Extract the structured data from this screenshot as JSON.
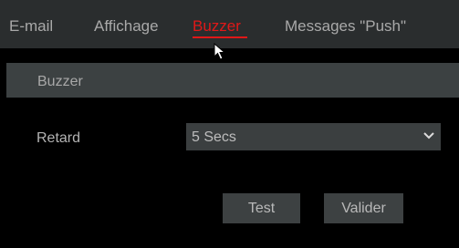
{
  "tabs": [
    {
      "label": "E-mail",
      "active": false
    },
    {
      "label": "Affichage",
      "active": false
    },
    {
      "label": "Buzzer",
      "active": true
    },
    {
      "label": "Messages \"Push\"",
      "active": false
    }
  ],
  "section": {
    "title": "Buzzer"
  },
  "form": {
    "delay_label": "Retard",
    "delay_value": "5 Secs"
  },
  "buttons": {
    "test_label": "Test",
    "submit_label": "Valider"
  },
  "colors": {
    "active_tab": "#e01818",
    "background": "#000000",
    "tab_bar": "#2a2d2e",
    "panel": "#3c4142"
  }
}
